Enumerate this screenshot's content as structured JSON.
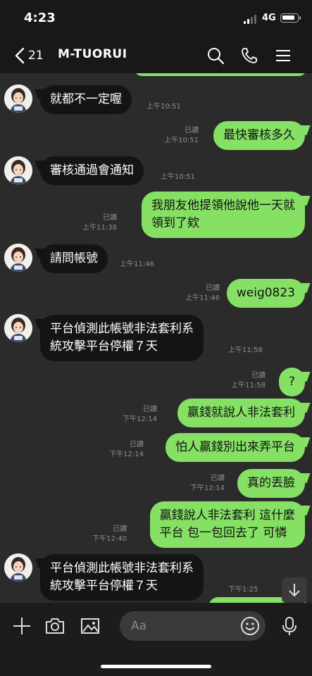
{
  "status": {
    "time": "4:23",
    "network": "4G"
  },
  "header": {
    "back_count": "21",
    "chat_name": "M-TUORUI"
  },
  "messages": [
    {
      "side": "in",
      "text": "就都不一定喔",
      "read": "",
      "time": "上午10:51"
    },
    {
      "side": "out",
      "text": "最快審核多久",
      "read": "已讀",
      "time": "上午10:51"
    },
    {
      "side": "in",
      "text": "審核通過會通知",
      "read": "",
      "time": "上午10:51"
    },
    {
      "side": "out",
      "text": "我朋友他提領他說他一天就\n領到了欸",
      "read": "已讀",
      "time": "上午11:38"
    },
    {
      "side": "in",
      "text": "請問帳號",
      "read": "",
      "time": "上午11:46"
    },
    {
      "side": "out",
      "text": "weig0823",
      "read": "已讀",
      "time": "上午11:46"
    },
    {
      "side": "in",
      "text": "平台偵測此帳號非法套利系\n統攻擊平台停權７天",
      "read": "",
      "time": "上午11:58"
    },
    {
      "side": "out",
      "text": "?",
      "read": "已讀",
      "time": "上午11:58"
    },
    {
      "side": "out",
      "text": "贏錢就說人非法套利",
      "read": "已讀",
      "time": "下午12:14"
    },
    {
      "side": "out",
      "text": "怕人贏錢別出來弄平台",
      "read": "已讀",
      "time": "下午12:14"
    },
    {
      "side": "out",
      "text": "真的丟臉",
      "read": "已讀",
      "time": "下午12:14"
    },
    {
      "side": "out",
      "text": "贏錢說人非法套利 這什麼\n平台 包一包回去了 可憐",
      "read": "已讀",
      "time": "下午12:40"
    },
    {
      "side": "in",
      "text": "平台偵測此帳號非法套利系\n統攻擊平台停權７天",
      "read": "",
      "time": "下午1:25"
    }
  ],
  "input": {
    "placeholder": "Aa"
  },
  "colors": {
    "outgoing_bubble": "#85e064",
    "incoming_bubble": "#141414",
    "background": "#2b2b2b"
  }
}
